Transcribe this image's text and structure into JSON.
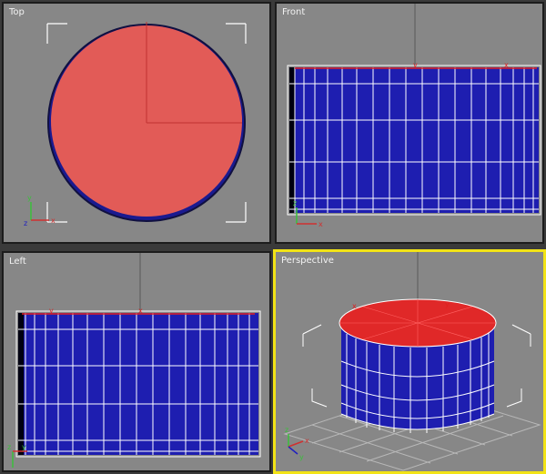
{
  "viewports": {
    "top": {
      "label": "Top"
    },
    "front": {
      "label": "Front"
    },
    "left": {
      "label": "Left"
    },
    "perspective": {
      "label": "Perspective"
    }
  },
  "axis_labels": {
    "x": "x",
    "y": "y",
    "z": "z"
  },
  "colors": {
    "viewport_bg": "#878787",
    "active_border": "#f2e316",
    "selection_red": "#e05a55",
    "mesh_blue": "#1a1ab0",
    "wire_white": "#ffffff"
  }
}
